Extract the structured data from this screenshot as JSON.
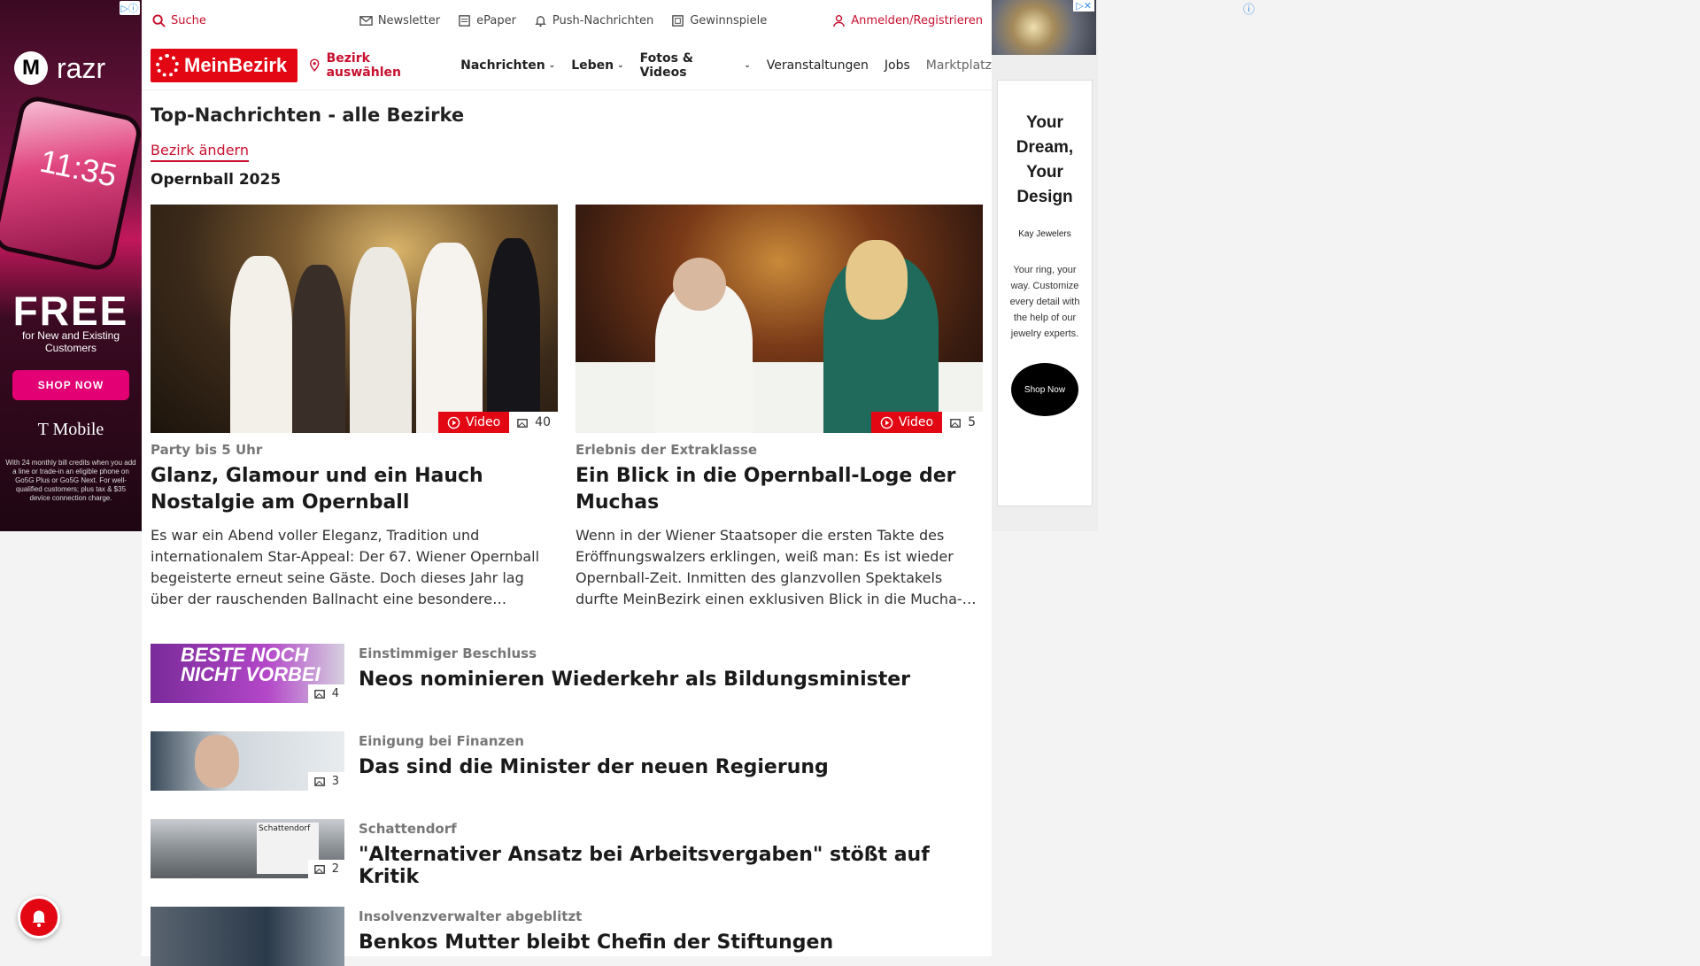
{
  "ads": {
    "left": {
      "brand": "razr",
      "phone_time": "11:35",
      "headline": "FREE",
      "sub": "for New and Existing Customers",
      "cta": "SHOP NOW",
      "carrier": "T Mobile",
      "fine_print": "With 24 monthly bill credits when you add a line or trade-in an eligible phone on Go5G Plus or Go5G Next. For well-qualified customers; plus tax & $35 device connection charge."
    },
    "right": {
      "title": "Your Dream, Your Design",
      "advertiser": "Kay Jewelers",
      "body": "Your ring, your way. Customize every detail with the help of our jewelry experts.",
      "cta": "Shop Now"
    }
  },
  "topbar": {
    "search": "Suche",
    "newsletter": "Newsletter",
    "epaper": "ePaper",
    "push": "Push-Nachrichten",
    "contests": "Gewinnspiele",
    "login": "Anmelden/Registrieren"
  },
  "nav": {
    "logo": "MeinBezirk",
    "select_district": "Bezirk auswählen",
    "items": [
      "Nachrichten",
      "Leben",
      "Fotos & Videos",
      "Veranstaltungen",
      "Jobs",
      "Marktplatz"
    ]
  },
  "page": {
    "title": "Top-Nachrichten - alle Bezirke",
    "change_district": "Bezirk ändern",
    "section": "Opernball 2025"
  },
  "features": [
    {
      "kicker": "Party bis 5 Uhr",
      "headline": "Glanz, Glamour und ein Hauch Nostalgie am Opernball",
      "teaser": "Es war ein Abend voller Eleganz, Tradition und internationalem Star-Appeal: Der 67. Wiener Opernball begeisterte erneut seine Gäste. Doch dieses Jahr lag über der rauschenden Ballnacht eine besondere…",
      "video_label": "Video",
      "photo_count": "40"
    },
    {
      "kicker": "Erlebnis der Extraklasse",
      "headline": "Ein Blick in die Opernball-Loge der Muchas",
      "teaser": "Wenn in der Wiener Staatsoper die ersten Takte des Eröffnungswalzers erklingen, weiß man: Es ist wieder Opernball-Zeit. Inmitten des glanzvollen Spektakels durfte MeinBezirk einen exklusiven Blick in die Mucha-…",
      "video_label": "Video",
      "photo_count": "5"
    }
  ],
  "list": [
    {
      "kicker": "Einstimmiger Beschluss",
      "headline": "Neos nominieren Wiederkehr als Bildungsminister",
      "photo_count": "4",
      "thumb_text": "BESTE NOCH NICHT VORBEI"
    },
    {
      "kicker": "Einigung bei Finanzen",
      "headline": "Das sind die Minister der neuen Regierung",
      "photo_count": "3"
    },
    {
      "kicker": "Schattendorf",
      "headline": "\"Alternativer Ansatz bei Arbeitsvergaben\" stößt auf Kritik",
      "photo_count": "2",
      "thumb_text": "Schattendorf"
    },
    {
      "kicker": "Insolvenzverwalter abgeblitzt",
      "headline": "Benkos Mutter bleibt Chefin der Stiftungen"
    }
  ]
}
